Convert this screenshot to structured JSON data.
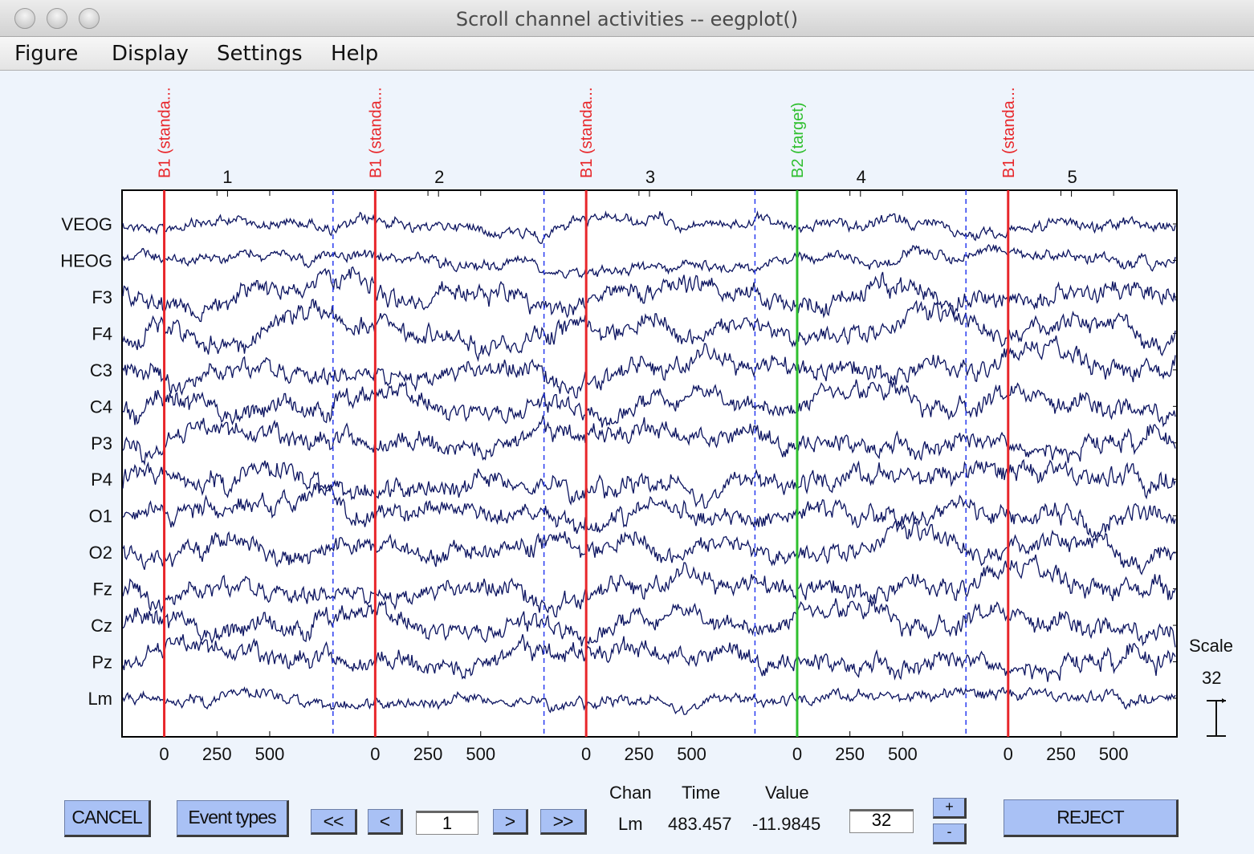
{
  "window": {
    "title": "Scroll channel activities -- eegplot()"
  },
  "menu": [
    "Figure",
    "Display",
    "Settings",
    "Help"
  ],
  "plot": {
    "channels": [
      "VEOG",
      "HEOG",
      "F3",
      "F4",
      "C3",
      "C4",
      "P3",
      "P4",
      "O1",
      "O2",
      "Fz",
      "Cz",
      "Pz",
      "Lm"
    ],
    "epochs": [
      "1",
      "2",
      "3",
      "4",
      "5"
    ],
    "epoch_range_ms": [
      -200,
      800
    ],
    "x_ticks": [
      "0",
      "250",
      "500"
    ],
    "events": [
      {
        "label": "B1 (standa...",
        "epoch": 1,
        "time_ms": 0,
        "color": "#e8262a"
      },
      {
        "label": "B1 (standa...",
        "epoch": 2,
        "time_ms": 0,
        "color": "#e8262a"
      },
      {
        "label": "B1 (standa...",
        "epoch": 3,
        "time_ms": 0,
        "color": "#e8262a"
      },
      {
        "label": "B2 (target)",
        "epoch": 4,
        "time_ms": 0,
        "color": "#2fbf2f"
      },
      {
        "label": "B1 (standa...",
        "epoch": 5,
        "time_ms": 0,
        "color": "#e8262a"
      }
    ],
    "trace_color": "#0c1460",
    "boundary_color": "#2a3cf0",
    "scale_label": "Scale",
    "scale_value": "32"
  },
  "controls": {
    "cancel": "CANCEL",
    "event_types": "Event types",
    "first": "<<",
    "prev": "<",
    "page": "1",
    "next": ">",
    "last": ">>",
    "chan_header": "Chan",
    "time_header": "Time",
    "value_header": "Value",
    "chan": "Lm",
    "time": "483.457",
    "value": "-11.9845",
    "scale_input": "32",
    "plus": "+",
    "minus": "-",
    "reject": "REJECT"
  }
}
